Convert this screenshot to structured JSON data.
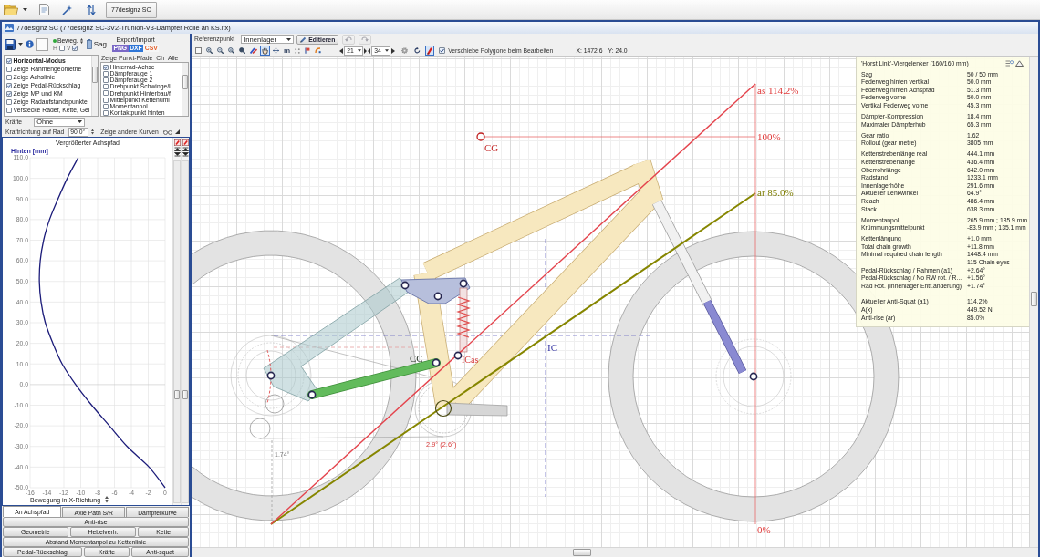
{
  "taskbar": {
    "tab": "77designz SC"
  },
  "window": {
    "title": "77designz SC (77designz SC-3V2-Trunion-V3-Dämpfer Rolle an KS.ltx)"
  },
  "file_toolbar": {
    "move_button": "Beweg.",
    "h_label": "H",
    "h_checked": false,
    "v_label": "V",
    "v_checked": true,
    "sag_button": "Sag",
    "export_label": "Export/Import",
    "formats": [
      {
        "label": "PNG",
        "kind": "filled",
        "color": "#7a68c6"
      },
      {
        "label": "DXF",
        "kind": "filled",
        "color": "#2f76d6"
      },
      {
        "label": "CSV",
        "kind": "text",
        "color": "#e5602a"
      }
    ]
  },
  "display_options": [
    {
      "label": "Horizontal-Modus",
      "kind": "mode",
      "checked": true
    },
    {
      "label": "Zeige Rahmengeometrie",
      "kind": "option",
      "checked": false
    },
    {
      "label": "Zeige Achslinie",
      "kind": "option",
      "checked": false
    },
    {
      "label": "Zeige Pedal-Rückschlag",
      "kind": "option",
      "checked": true
    },
    {
      "label": "Zeige MP und KM",
      "kind": "option",
      "checked": true
    },
    {
      "label": "Zeige Radaufstandspunkte",
      "kind": "option",
      "checked": false
    },
    {
      "label": "Verstecke Räder, Kette, Gel",
      "kind": "option",
      "checked": false
    }
  ],
  "point_paths": {
    "title": "Zeige Punkt-Pfade",
    "buttons": [
      "Ch",
      "Alle"
    ],
    "items": [
      {
        "label": "Hinterrad-Achse",
        "checked": true
      },
      {
        "label": "Dämpferauge 1",
        "checked": false
      },
      {
        "label": "Dämpferauge 2",
        "checked": false
      },
      {
        "label": "Drehpunkt Schwinge/L",
        "checked": false
      },
      {
        "label": "Drehpunkt Hinterbau/f",
        "checked": false
      },
      {
        "label": "Mittelpunkt Kettenumi",
        "checked": false
      },
      {
        "label": "Momentanpol",
        "checked": false
      },
      {
        "label": "Kontaktpunkt hinten",
        "checked": false
      }
    ]
  },
  "forces": {
    "label": "Kräfte",
    "value": "Ohne"
  },
  "force_direction": {
    "label": "Kraftrichtung auf Rad",
    "value": "90.0°",
    "other_curves": "Zeige andere Kurven"
  },
  "axle_path_chart": {
    "chart_data": {
      "type": "line",
      "title": "Vergrößerter Achspfad",
      "xlabel": "Bewegung in X-Richtung",
      "ylabel": "Hinten [mm]",
      "grid": true,
      "x": [
        0,
        -1.9,
        -4.5,
        -6.6,
        -8.7,
        -10.6,
        -12.2,
        -13.3,
        -14.2,
        -14.7,
        -14.9,
        -14.8,
        -14.4,
        -13.7,
        -12.7,
        -11.6,
        -10.3
      ],
      "series": [
        {
          "color": "#1c1c7a",
          "values": [
            -50,
            -40,
            -30,
            -20,
            -10,
            0,
            10,
            20,
            30,
            40,
            50,
            60,
            70,
            80,
            90,
            100,
            110
          ]
        }
      ],
      "xlim": [
        -16,
        0
      ],
      "ylim": [
        -50,
        110
      ],
      "xticks": [
        -16,
        -14,
        -12,
        -10,
        -8,
        -6,
        -4,
        -2,
        0
      ],
      "yticks": [
        {
          "value": 110,
          "label": "110.0"
        },
        {
          "value": 100,
          "label": "100.0"
        },
        {
          "value": 90,
          "label": "90.0"
        },
        {
          "value": 80,
          "label": "80.0"
        },
        {
          "value": 70,
          "label": "70.0"
        },
        {
          "value": 60,
          "label": "60.0"
        },
        {
          "value": 50,
          "label": "50.0"
        },
        {
          "value": 40,
          "label": "40.0"
        },
        {
          "value": 30,
          "label": "30.0"
        },
        {
          "value": 20,
          "label": "20.0"
        },
        {
          "value": 10,
          "label": "10.0"
        },
        {
          "value": 0,
          "label": "0.0"
        },
        {
          "value": -10,
          "label": "-10.0"
        },
        {
          "value": -20,
          "label": "-20.0"
        },
        {
          "value": -30,
          "label": "-30.0"
        },
        {
          "value": -40,
          "label": "-40.0"
        },
        {
          "value": -50,
          "label": "-50.0"
        }
      ]
    }
  },
  "chart_tabs": [
    {
      "label": "An Achspfad",
      "selected": true
    },
    {
      "label": "Axle Path S/R",
      "selected": false
    },
    {
      "label": "Dämpferkurve",
      "selected": false
    }
  ],
  "analysis_buttons": [
    [
      "Anti-rise"
    ],
    [
      "Geometrie",
      "Hebelverh.",
      "Kette"
    ],
    [
      "Abstand Momentanpol zu Kettenlinie"
    ],
    [
      "Pedal-Rückschlag",
      "Kräfte",
      "Anti-squat"
    ]
  ],
  "main_toolbar": {
    "reference_label": "Referenzpunkt",
    "reference_value": "Innenlager",
    "edit_button": "Editieren",
    "history_buttons": [
      {
        "kind": "undo",
        "disabled": true
      },
      {
        "kind": "redo",
        "disabled": true
      }
    ],
    "tools": [
      {
        "kind": "frame",
        "selected": false
      },
      {
        "kind": "zoom_in",
        "selected": false
      },
      {
        "kind": "zoom_out",
        "selected": false
      },
      {
        "kind": "zoom_fit",
        "selected": false
      },
      {
        "kind": "zoom",
        "selected": false
      },
      {
        "kind": "palette",
        "selected": false
      },
      {
        "kind": "hand",
        "selected": true
      },
      {
        "kind": "move",
        "selected": false
      },
      {
        "kind": "text",
        "label": "m",
        "selected": false
      },
      {
        "kind": "grid",
        "selected": false
      },
      {
        "kind": "flag",
        "selected": false
      },
      {
        "kind": "curve",
        "selected": false
      }
    ],
    "frame_a": "21",
    "frame_b": "34",
    "toggles": [
      {
        "kind": "gear",
        "selected": false
      },
      {
        "kind": "rotate",
        "selected": false
      },
      {
        "kind": "marker",
        "selected": true
      }
    ],
    "move_polygons": {
      "label": "Verschiebe Polygone beim Bearbeiten",
      "checked": true
    },
    "x_reading": "X: 1472.6",
    "y_reading": "Y: 24.0"
  },
  "canvas": {
    "anti_squat_label": "as 114.2%",
    "top_label": "100%",
    "cg_label": "CG",
    "anti_rise_label": "ar 85.0%",
    "ic_label": "IC",
    "cc_label": "CC",
    "icas_label": "ICas",
    "bottom_label": "0%",
    "angle_label": "2.9° (2.6°)",
    "rotation_label": "1.74°"
  },
  "info_panel": {
    "title": "'Horst Link'-Viergelenker (160/160 mm)",
    "groups": [
      {
        "rows": [
          {
            "label": "Sag",
            "value": "50 / 50 mm"
          },
          {
            "label": "Federweg hinten vertikal",
            "value": "50.0 mm"
          },
          {
            "label": "Federweg hinten Achspfad",
            "value": "51.3 mm"
          },
          {
            "label": "Federweg vorne",
            "value": "50.0 mm"
          },
          {
            "label": "Vertikal Federweg vorne",
            "value": "45.3 mm"
          }
        ]
      },
      {
        "rows": [
          {
            "label": "Dämpfer-Kompression",
            "value": "18.4 mm"
          },
          {
            "label": "Maximaler Dämpferhub",
            "value": "65.3 mm"
          }
        ]
      },
      {
        "rows": [
          {
            "label": "Gear ratio",
            "value": "1.62"
          },
          {
            "label": "Rollout (gear metre)",
            "value": "3805 mm"
          }
        ]
      },
      {
        "rows": [
          {
            "label": "Kettenstrebenlänge real",
            "value": "444.1 mm"
          },
          {
            "label": "Kettenstrebenlänge",
            "value": "436.4 mm"
          },
          {
            "label": "Oberrohrlänge",
            "value": "642.0 mm"
          },
          {
            "label": "Radstand",
            "value": "1233.1 mm"
          },
          {
            "label": "Innenlagerhöhe",
            "value": "291.6 mm"
          },
          {
            "label": "Aktueller Lenkwinkel",
            "value": "64.9°"
          },
          {
            "label": "Reach",
            "value": "486.4 mm"
          },
          {
            "label": "Stack",
            "value": "638.3 mm"
          }
        ]
      },
      {
        "rows": [
          {
            "label": "Momentanpol",
            "value": "265.9 mm ; 185.9 mm"
          },
          {
            "label": "Krümmungsmittelpunkt",
            "value": "-83.9 mm ; 135.1 mm"
          }
        ]
      },
      {
        "rows": [
          {
            "label": "Kettenlängung",
            "value": "+1.0 mm"
          },
          {
            "label": "Total chain growth",
            "value": "+11.8 mm"
          },
          {
            "label": "Minimal required chain length",
            "value": "1448.4 mm"
          },
          {
            "value": "115 Chain eyes"
          },
          {
            "label": "Pedal-Rückschlag / Rahmen (a1)",
            "value": "+2.64°"
          },
          {
            "label": "Pedal-Rückschlag / No RW rot. / R...",
            "value": "+1.56°"
          },
          {
            "label": "Rad Rot. (Innenlager Entf.änderung)",
            "value": "+1.74°"
          }
        ]
      },
      {
        "rows": [
          {
            "label": "Aktueller Anti-Squat (a1)",
            "value": "114.2%"
          },
          {
            "label": "A(x)",
            "value": "449.52 N"
          },
          {
            "label": "Anti-rise (ar)",
            "value": "85.0%"
          }
        ]
      }
    ]
  }
}
